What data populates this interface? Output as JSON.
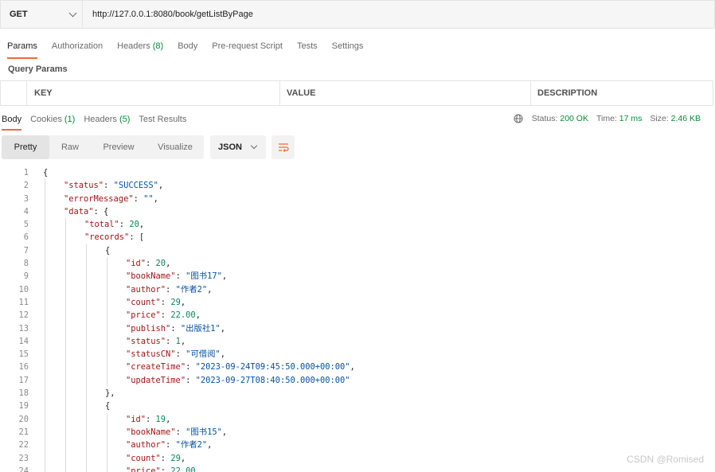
{
  "request": {
    "method": "GET",
    "url": "http://127.0.0.1:8080/book/getListByPage"
  },
  "request_tabs": [
    {
      "label": "Params",
      "count": ""
    },
    {
      "label": "Authorization",
      "count": ""
    },
    {
      "label": "Headers ",
      "count": "(8)"
    },
    {
      "label": "Body",
      "count": ""
    },
    {
      "label": "Pre-request Script",
      "count": ""
    },
    {
      "label": "Tests",
      "count": ""
    },
    {
      "label": "Settings",
      "count": ""
    }
  ],
  "query_params": {
    "title": "Query Params",
    "columns": {
      "key": "KEY",
      "value": "VALUE",
      "description": "DESCRIPTION"
    }
  },
  "response_tabs": [
    {
      "label": "Body",
      "count": ""
    },
    {
      "label": "Cookies ",
      "count": "(1)"
    },
    {
      "label": "Headers ",
      "count": "(5)"
    },
    {
      "label": "Test Results",
      "count": ""
    }
  ],
  "response_status": {
    "status_label": "Status:",
    "status_value": "200 OK",
    "time_label": "Time:",
    "time_value": "17 ms",
    "size_label": "Size:",
    "size_value": "2.46 KB"
  },
  "view_modes": [
    "Pretty",
    "Raw",
    "Preview",
    "Visualize"
  ],
  "format": "JSON",
  "code_lines": [
    {
      "n": "1",
      "depth": 0,
      "parts": [
        {
          "t": "p",
          "v": "{"
        }
      ]
    },
    {
      "n": "2",
      "depth": 1,
      "parts": [
        {
          "t": "k",
          "v": "\"status\""
        },
        {
          "t": "p",
          "v": ": "
        },
        {
          "t": "s",
          "v": "\"SUCCESS\""
        },
        {
          "t": "p",
          "v": ","
        }
      ]
    },
    {
      "n": "3",
      "depth": 1,
      "parts": [
        {
          "t": "k",
          "v": "\"errorMessage\""
        },
        {
          "t": "p",
          "v": ": "
        },
        {
          "t": "s",
          "v": "\"\""
        },
        {
          "t": "p",
          "v": ","
        }
      ]
    },
    {
      "n": "4",
      "depth": 1,
      "parts": [
        {
          "t": "k",
          "v": "\"data\""
        },
        {
          "t": "p",
          "v": ": {"
        }
      ]
    },
    {
      "n": "5",
      "depth": 2,
      "parts": [
        {
          "t": "k",
          "v": "\"total\""
        },
        {
          "t": "p",
          "v": ": "
        },
        {
          "t": "n",
          "v": "20"
        },
        {
          "t": "p",
          "v": ","
        }
      ]
    },
    {
      "n": "6",
      "depth": 2,
      "parts": [
        {
          "t": "k",
          "v": "\"records\""
        },
        {
          "t": "p",
          "v": ": ["
        }
      ]
    },
    {
      "n": "7",
      "depth": 3,
      "parts": [
        {
          "t": "p",
          "v": "{"
        }
      ]
    },
    {
      "n": "8",
      "depth": 4,
      "parts": [
        {
          "t": "k",
          "v": "\"id\""
        },
        {
          "t": "p",
          "v": ": "
        },
        {
          "t": "n",
          "v": "20"
        },
        {
          "t": "p",
          "v": ","
        }
      ]
    },
    {
      "n": "9",
      "depth": 4,
      "parts": [
        {
          "t": "k",
          "v": "\"bookName\""
        },
        {
          "t": "p",
          "v": ": "
        },
        {
          "t": "s",
          "v": "\"图书17\""
        },
        {
          "t": "p",
          "v": ","
        }
      ]
    },
    {
      "n": "10",
      "depth": 4,
      "parts": [
        {
          "t": "k",
          "v": "\"author\""
        },
        {
          "t": "p",
          "v": ": "
        },
        {
          "t": "s",
          "v": "\"作者2\""
        },
        {
          "t": "p",
          "v": ","
        }
      ]
    },
    {
      "n": "11",
      "depth": 4,
      "parts": [
        {
          "t": "k",
          "v": "\"count\""
        },
        {
          "t": "p",
          "v": ": "
        },
        {
          "t": "n",
          "v": "29"
        },
        {
          "t": "p",
          "v": ","
        }
      ]
    },
    {
      "n": "12",
      "depth": 4,
      "parts": [
        {
          "t": "k",
          "v": "\"price\""
        },
        {
          "t": "p",
          "v": ": "
        },
        {
          "t": "n",
          "v": "22.00"
        },
        {
          "t": "p",
          "v": ","
        }
      ]
    },
    {
      "n": "13",
      "depth": 4,
      "parts": [
        {
          "t": "k",
          "v": "\"publish\""
        },
        {
          "t": "p",
          "v": ": "
        },
        {
          "t": "s",
          "v": "\"出版社1\""
        },
        {
          "t": "p",
          "v": ","
        }
      ]
    },
    {
      "n": "14",
      "depth": 4,
      "parts": [
        {
          "t": "k",
          "v": "\"status\""
        },
        {
          "t": "p",
          "v": ": "
        },
        {
          "t": "n",
          "v": "1"
        },
        {
          "t": "p",
          "v": ","
        }
      ]
    },
    {
      "n": "15",
      "depth": 4,
      "parts": [
        {
          "t": "k",
          "v": "\"statusCN\""
        },
        {
          "t": "p",
          "v": ": "
        },
        {
          "t": "s",
          "v": "\"可借阅\""
        },
        {
          "t": "p",
          "v": ","
        }
      ]
    },
    {
      "n": "16",
      "depth": 4,
      "parts": [
        {
          "t": "k",
          "v": "\"createTime\""
        },
        {
          "t": "p",
          "v": ": "
        },
        {
          "t": "s",
          "v": "\"2023-09-24T09:45:50.000+00:00\""
        },
        {
          "t": "p",
          "v": ","
        }
      ]
    },
    {
      "n": "17",
      "depth": 4,
      "parts": [
        {
          "t": "k",
          "v": "\"updateTime\""
        },
        {
          "t": "p",
          "v": ": "
        },
        {
          "t": "s",
          "v": "\"2023-09-27T08:40:50.000+00:00\""
        }
      ]
    },
    {
      "n": "18",
      "depth": 3,
      "parts": [
        {
          "t": "p",
          "v": "},"
        }
      ]
    },
    {
      "n": "19",
      "depth": 3,
      "parts": [
        {
          "t": "p",
          "v": "{"
        }
      ]
    },
    {
      "n": "20",
      "depth": 4,
      "parts": [
        {
          "t": "k",
          "v": "\"id\""
        },
        {
          "t": "p",
          "v": ": "
        },
        {
          "t": "n",
          "v": "19"
        },
        {
          "t": "p",
          "v": ","
        }
      ]
    },
    {
      "n": "21",
      "depth": 4,
      "parts": [
        {
          "t": "k",
          "v": "\"bookName\""
        },
        {
          "t": "p",
          "v": ": "
        },
        {
          "t": "s",
          "v": "\"图书15\""
        },
        {
          "t": "p",
          "v": ","
        }
      ]
    },
    {
      "n": "22",
      "depth": 4,
      "parts": [
        {
          "t": "k",
          "v": "\"author\""
        },
        {
          "t": "p",
          "v": ": "
        },
        {
          "t": "s",
          "v": "\"作者2\""
        },
        {
          "t": "p",
          "v": ","
        }
      ]
    },
    {
      "n": "23",
      "depth": 4,
      "parts": [
        {
          "t": "k",
          "v": "\"count\""
        },
        {
          "t": "p",
          "v": ": "
        },
        {
          "t": "n",
          "v": "29"
        },
        {
          "t": "p",
          "v": ","
        }
      ]
    },
    {
      "n": "24",
      "depth": 4,
      "parts": [
        {
          "t": "k",
          "v": "\"price\""
        },
        {
          "t": "p",
          "v": ": "
        },
        {
          "t": "n",
          "v": "22.00"
        }
      ]
    }
  ],
  "watermark": "CSDN @Romised",
  "colors": {
    "accent": "#f26b3a",
    "count_green": "#0a8a3a",
    "json_key": "#a31515",
    "json_string": "#0451a5",
    "json_number": "#098658"
  },
  "icons": {
    "method_dropdown": "chevron-down-icon",
    "globe": "globe-icon",
    "format_dropdown": "chevron-down-icon",
    "wrap": "wrap-lines-icon"
  }
}
